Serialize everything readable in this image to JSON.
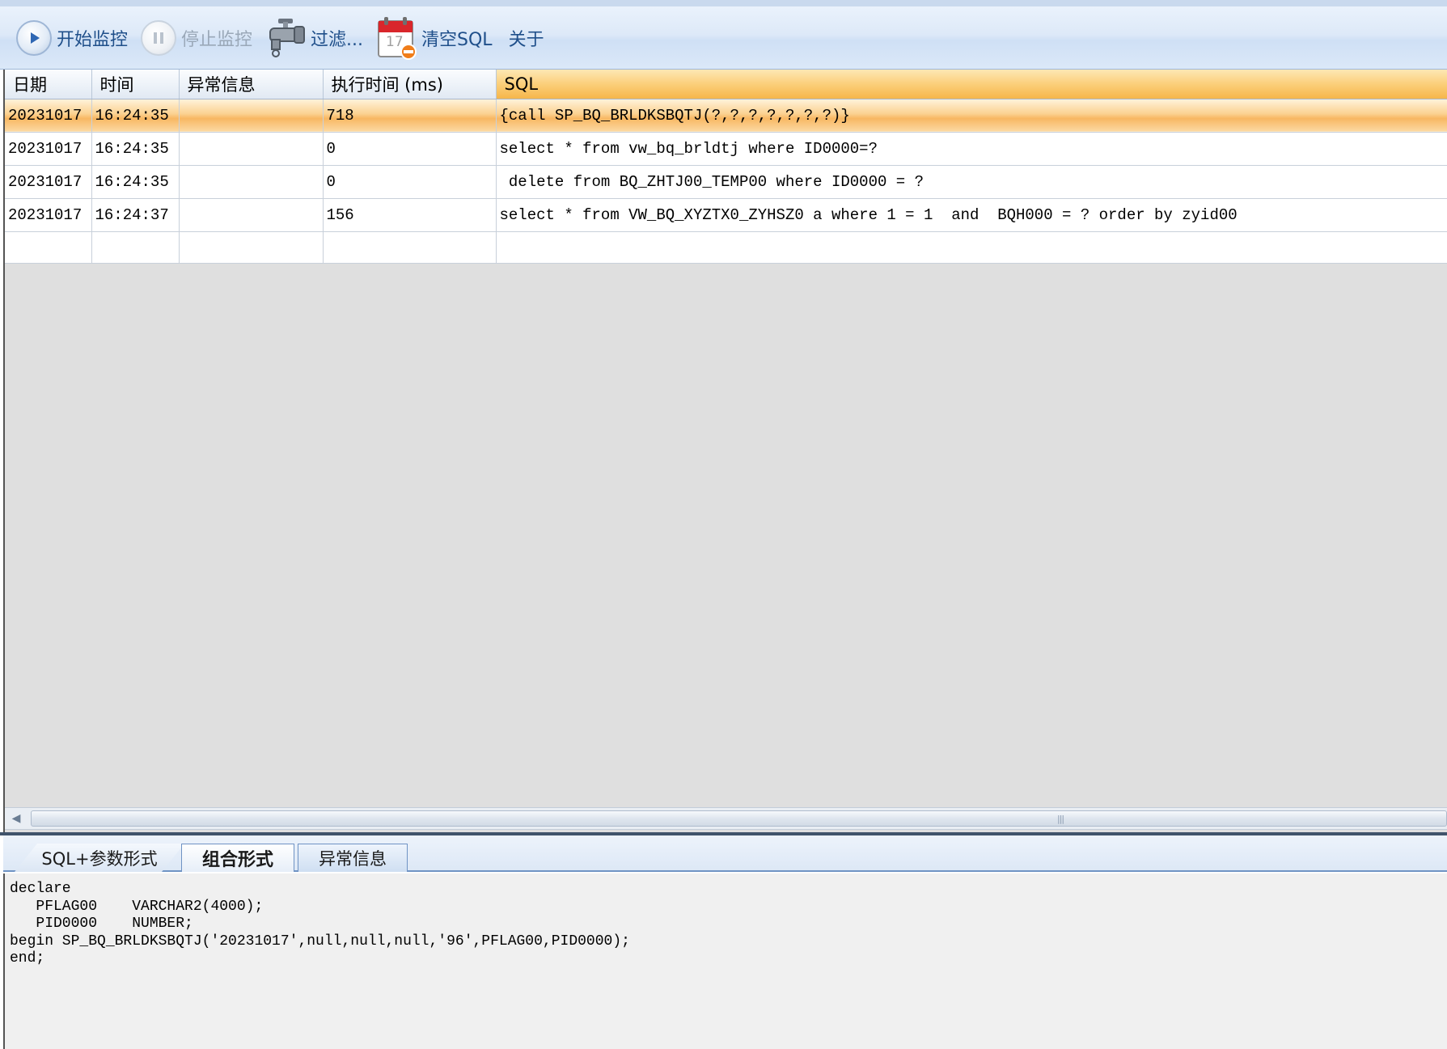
{
  "toolbar": {
    "start_label": "开始监控",
    "stop_label": "停止监控",
    "filter_label": "过滤...",
    "clear_label": "清空SQL",
    "about_label": "关于",
    "calendar_day": "17"
  },
  "grid": {
    "columns": [
      "日期",
      "时间",
      "异常信息",
      "执行时间 (ms)",
      "SQL"
    ],
    "rows": [
      {
        "date": "20231017",
        "time": "16:24:35",
        "error": "",
        "duration": "718",
        "sql": "{call SP_BQ_BRLDKSBQTJ(?,?,?,?,?,?,?)}"
      },
      {
        "date": "20231017",
        "time": "16:24:35",
        "error": "",
        "duration": "0",
        "sql": "select * from vw_bq_brldtj where ID0000=?"
      },
      {
        "date": "20231017",
        "time": "16:24:35",
        "error": "",
        "duration": "0",
        "sql": " delete from BQ_ZHTJ00_TEMP00 where ID0000 = ?"
      },
      {
        "date": "20231017",
        "time": "16:24:37",
        "error": "",
        "duration": "156",
        "sql": "select * from VW_BQ_XYZTX0_ZYHSZ0 a where 1 = 1  and  BQH000 = ? order by zyid00"
      }
    ]
  },
  "tabs": {
    "sql_params": "SQL+参数形式",
    "combined": "组合形式",
    "error_info": "异常信息"
  },
  "sql_text": "declare\n   PFLAG00    VARCHAR2(4000);\n   PID0000    NUMBER;\nbegin SP_BQ_BRLDKSBQTJ('20231017',null,null,null,'96',PFLAG00,PID0000);\nend;",
  "colors": {
    "selected_row": "#f8b762",
    "toolbar_text": "#1f4f8a",
    "splitter": "#40536b"
  }
}
